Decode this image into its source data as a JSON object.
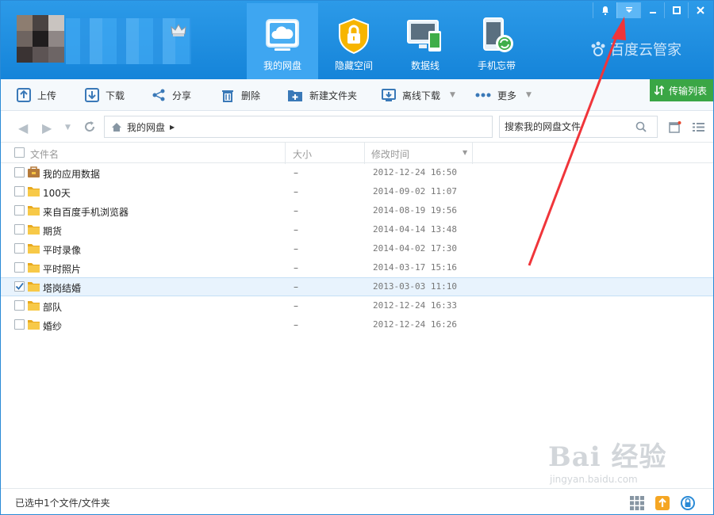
{
  "header": {
    "tabs": [
      {
        "label": "我的网盘",
        "icon": "cloud-icon",
        "active": true
      },
      {
        "label": "隐藏空间",
        "icon": "lock-icon",
        "active": false
      },
      {
        "label": "数据线",
        "icon": "devices-icon",
        "active": false
      },
      {
        "label": "手机忘带",
        "icon": "phone-sync-icon",
        "active": false
      }
    ],
    "brand": "百度云管家",
    "window_buttons": [
      "bell-icon",
      "dropdown-menu-icon",
      "minimize-icon",
      "maximize-icon",
      "close-icon"
    ]
  },
  "toolbar": {
    "upload": "上传",
    "download": "下载",
    "share": "分享",
    "delete": "删除",
    "new_folder": "新建文件夹",
    "offline_download": "离线下载",
    "more": "更多",
    "transfer_list": "传输列表"
  },
  "address": {
    "path": "我的网盘",
    "search_placeholder": "搜索我的网盘文件"
  },
  "table": {
    "columns": {
      "name": "文件名",
      "size": "大小",
      "modified": "修改时间"
    },
    "rows": [
      {
        "name": "我的应用数据",
        "size": "–",
        "modified": "2012-12-24 16:50",
        "type": "app-folder",
        "checked": false
      },
      {
        "name": "100天",
        "size": "–",
        "modified": "2014-09-02 11:07",
        "type": "folder",
        "checked": false
      },
      {
        "name": "来自百度手机浏览器",
        "size": "–",
        "modified": "2014-08-19 19:56",
        "type": "folder",
        "checked": false
      },
      {
        "name": "期货",
        "size": "–",
        "modified": "2014-04-14 13:48",
        "type": "folder",
        "checked": false
      },
      {
        "name": "平时录像",
        "size": "–",
        "modified": "2014-04-02 17:30",
        "type": "folder",
        "checked": false
      },
      {
        "name": "平时照片",
        "size": "–",
        "modified": "2014-03-17 15:16",
        "type": "folder",
        "checked": false
      },
      {
        "name": "塔岗结婚",
        "size": "–",
        "modified": "2013-03-03 11:10",
        "type": "folder",
        "checked": true
      },
      {
        "name": "部队",
        "size": "–",
        "modified": "2012-12-24 16:33",
        "type": "folder",
        "checked": false
      },
      {
        "name": "婚纱",
        "size": "–",
        "modified": "2012-12-24 16:26",
        "type": "folder",
        "checked": false
      }
    ]
  },
  "status": {
    "text": "已选中1个文件/文件夹"
  },
  "watermark": {
    "logo": "Bai 经验",
    "url": "jingyan.baidu.com"
  },
  "colors": {
    "header": "#1e8fe0",
    "accent_green": "#3aa645",
    "folder": "#f5c342",
    "selected_row": "#e8f3fd",
    "annotation_arrow": "#f0353a"
  }
}
